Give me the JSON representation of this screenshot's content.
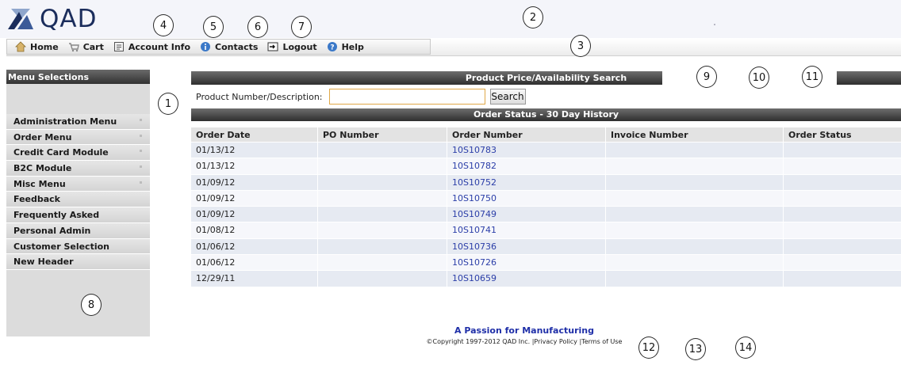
{
  "brand": {
    "logo_text": "QAD"
  },
  "nav": [
    {
      "label": "Home",
      "icon": "home-icon"
    },
    {
      "label": "Cart",
      "icon": "cart-icon"
    },
    {
      "label": "Account Info",
      "icon": "account-info-icon"
    },
    {
      "label": "Contacts",
      "icon": "contacts-info-icon"
    },
    {
      "label": "Logout",
      "icon": "logout-icon"
    },
    {
      "label": "Help",
      "icon": "help-icon"
    }
  ],
  "callouts": [
    "1",
    "2",
    "3",
    "4",
    "5",
    "6",
    "7",
    "8",
    "9",
    "10",
    "11",
    "12",
    "13",
    "14"
  ],
  "sidebar": {
    "title": "Menu Selections",
    "items": [
      {
        "label": "Administration Menu",
        "has_submenu": true
      },
      {
        "label": "Order Menu",
        "has_submenu": true
      },
      {
        "label": "Credit Card Module",
        "has_submenu": true
      },
      {
        "label": "B2C Module",
        "has_submenu": true
      },
      {
        "label": "Misc Menu",
        "has_submenu": true
      },
      {
        "label": "Feedback",
        "has_submenu": false
      },
      {
        "label": "Frequently Asked",
        "has_submenu": false
      },
      {
        "label": "Personal Admin",
        "has_submenu": false
      },
      {
        "label": "Customer Selection",
        "has_submenu": false
      },
      {
        "label": "New Header",
        "has_submenu": false
      }
    ]
  },
  "search": {
    "title": "Product Price/Availability Search",
    "label": "Product Number/Description:",
    "value": "",
    "button": "Search"
  },
  "orders": {
    "title": "Order Status - 30 Day History",
    "columns": [
      "Order Date",
      "PO Number",
      "Order Number",
      "Invoice Number",
      "Order Status"
    ],
    "rows": [
      {
        "date": "01/13/12",
        "po": "",
        "order": "10S10783",
        "invoice": "",
        "status": ""
      },
      {
        "date": "01/13/12",
        "po": "",
        "order": "10S10782",
        "invoice": "",
        "status": ""
      },
      {
        "date": "01/09/12",
        "po": "",
        "order": "10S10752",
        "invoice": "",
        "status": ""
      },
      {
        "date": "01/09/12",
        "po": "",
        "order": "10S10750",
        "invoice": "",
        "status": ""
      },
      {
        "date": "01/09/12",
        "po": "",
        "order": "10S10749",
        "invoice": "",
        "status": ""
      },
      {
        "date": "01/08/12",
        "po": "",
        "order": "10S10741",
        "invoice": "",
        "status": ""
      },
      {
        "date": "01/06/12",
        "po": "",
        "order": "10S10736",
        "invoice": "",
        "status": ""
      },
      {
        "date": "01/06/12",
        "po": "",
        "order": "10S10726",
        "invoice": "",
        "status": ""
      },
      {
        "date": "12/29/11",
        "po": "",
        "order": "10S10659",
        "invoice": "",
        "status": ""
      }
    ]
  },
  "footer": {
    "tagline": "A Passion for Manufacturing",
    "copyright": "©Copyright 1997-2012 QAD Inc.",
    "privacy": "Privacy Policy",
    "terms": "Terms of Use"
  },
  "colors": {
    "brand_navy": "#1b2d5c",
    "link_blue": "#2b3ea8",
    "bar_dark": "#2f2f2f",
    "row_alt": "#e6eaf2"
  }
}
